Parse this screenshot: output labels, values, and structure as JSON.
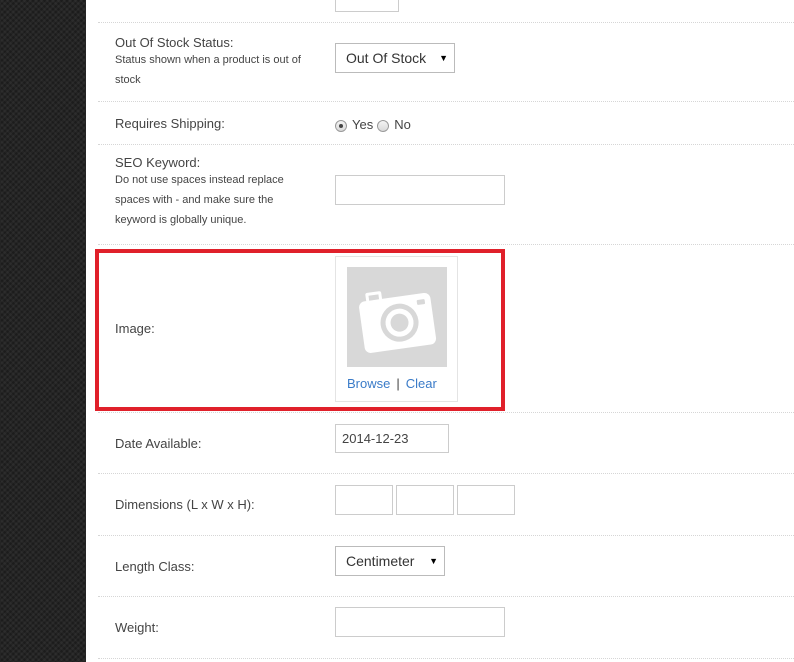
{
  "form": {
    "out_of_stock": {
      "label": "Out Of Stock Status:",
      "help": "Status shown when a product is out of stock",
      "selected": "Out Of Stock"
    },
    "requires_shipping": {
      "label": "Requires Shipping:",
      "yes": "Yes",
      "no": "No",
      "selected": "Yes"
    },
    "seo_keyword": {
      "label": "SEO Keyword:",
      "help": "Do not use spaces instead replace spaces with - and make sure the keyword is globally unique.",
      "value": ""
    },
    "image": {
      "label": "Image:",
      "browse": "Browse",
      "separator": "|",
      "clear": "Clear",
      "placeholder_icon": "camera-icon"
    },
    "date_available": {
      "label": "Date Available:",
      "value": "2014-12-23"
    },
    "dimensions": {
      "label": "Dimensions (L x W x H):",
      "length": "",
      "width": "",
      "height": ""
    },
    "length_class": {
      "label": "Length Class:",
      "selected": "Centimeter"
    },
    "weight": {
      "label": "Weight:",
      "value": ""
    }
  },
  "colors": {
    "highlight": "#e0202a",
    "link": "#3a7bc8",
    "rail": "#252525"
  }
}
